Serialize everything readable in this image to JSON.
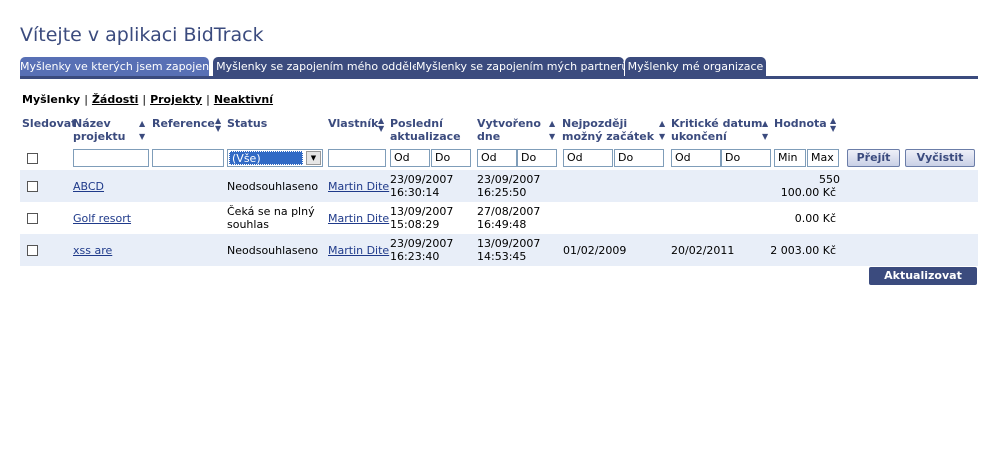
{
  "title": "Vítejte v aplikaci BidTrack",
  "tabs": [
    {
      "label": "Myšlenky ve kterých jsem zapojen"
    },
    {
      "label": "Myšlenky se zapojením mého oddělení"
    },
    {
      "label": "Myšlenky se zapojením mých partnerů"
    },
    {
      "label": "Myšlenky mé organizace"
    }
  ],
  "subnav": {
    "current": "Myšlenky",
    "links": [
      "Žádosti",
      "Projekty",
      "Neaktivní"
    ]
  },
  "columns": {
    "sledovat": "Sledovat",
    "nazev_1": "Název",
    "nazev_2": "projektu",
    "reference": "Reference",
    "status": "Status",
    "vlastnik": "Vlastník",
    "posledni_1": "Poslední",
    "posledni_2": "aktualizace",
    "vytvoreno_1": "Vytvořeno",
    "vytvoreno_2": "dne",
    "nejpozdeji_1": "Nejpozději",
    "nejpozdeji_2": "možný začátek",
    "kriticke_1": "Kritické datum",
    "kriticke_2": "ukončení",
    "hodnota": "Hodnota"
  },
  "filters": {
    "status_selected": "(Vše)",
    "od": "Od",
    "do": "Do",
    "min": "Min",
    "max": "Max",
    "go_label": "Přejít",
    "clear_label": "Vyčistit"
  },
  "rows": [
    {
      "name": "ABCD",
      "status_1": "Neodsouhlaseno",
      "status_2": "",
      "owner": "Martin Dite",
      "updated_date": "23/09/2007",
      "updated_time": "16:30:14",
      "created_date": "23/09/2007",
      "created_time": "16:25:50",
      "start": "",
      "end": "",
      "value_1": "550",
      "value_2": "100.00 Kč"
    },
    {
      "name": "Golf resort",
      "status_1": "Čeká se na plný",
      "status_2": "souhlas",
      "owner": "Martin Dite",
      "updated_date": "13/09/2007",
      "updated_time": "15:08:29",
      "created_date": "27/08/2007",
      "created_time": "16:49:48",
      "start": "",
      "end": "",
      "value_1": "0.00 Kč",
      "value_2": ""
    },
    {
      "name": "xss are",
      "status_1": "Neodsouhlaseno",
      "status_2": "",
      "owner": "Martin Dite",
      "updated_date": "23/09/2007",
      "updated_time": "16:23:40",
      "created_date": "13/09/2007",
      "created_time": "14:53:45",
      "start": "01/02/2009",
      "end": "20/02/2011",
      "value_1": "2 003.00 Kč",
      "value_2": ""
    }
  ],
  "update_label": "Aktualizovat",
  "colors": {
    "brand": "#3b4b7e",
    "active_tab": "#5870b5",
    "row_shade": "#e8eef8",
    "link": "#1f3a8a"
  }
}
